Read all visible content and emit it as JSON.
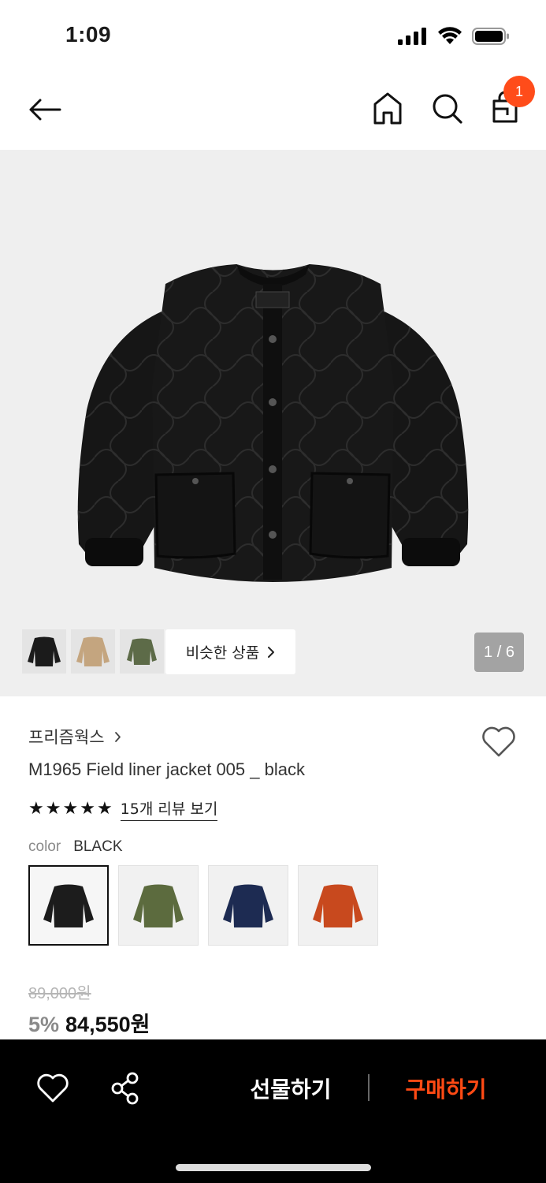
{
  "status_bar": {
    "time": "1:09",
    "icons": [
      "signal-icon",
      "wifi-icon",
      "battery-icon"
    ]
  },
  "nav": {
    "icons": [
      "back-arrow-icon",
      "home-icon",
      "search-icon",
      "shopping-bag-icon"
    ],
    "cart_badge": "1",
    "badge_color": "#ff4c1a"
  },
  "gallery": {
    "similar_label": "비슷한 상품",
    "page_indicator": "1 / 6",
    "thumbnails": [
      "black-jacket-thumb",
      "beige-jacket-thumb",
      "olive-jacket-thumb"
    ]
  },
  "product": {
    "brand": "프리즘웍스",
    "name": "M1965 Field liner jacket 005 _ black",
    "rating": 5,
    "review_link": "15개 리뷰 보기",
    "color_label": "color",
    "color_value": "BLACK",
    "swatches": [
      {
        "name": "black",
        "color": "#1c1c1c"
      },
      {
        "name": "olive",
        "color": "#5c6b3e"
      },
      {
        "name": "navy",
        "color": "#1d2b52"
      },
      {
        "name": "orange",
        "color": "#c8491e"
      }
    ],
    "original_price": "89,000원",
    "discount": "5%",
    "sale_price": "84,550원"
  },
  "bottom_bar": {
    "gift_label": "선물하기",
    "buy_label": "구매하기",
    "buy_color": "#ff4a14"
  }
}
